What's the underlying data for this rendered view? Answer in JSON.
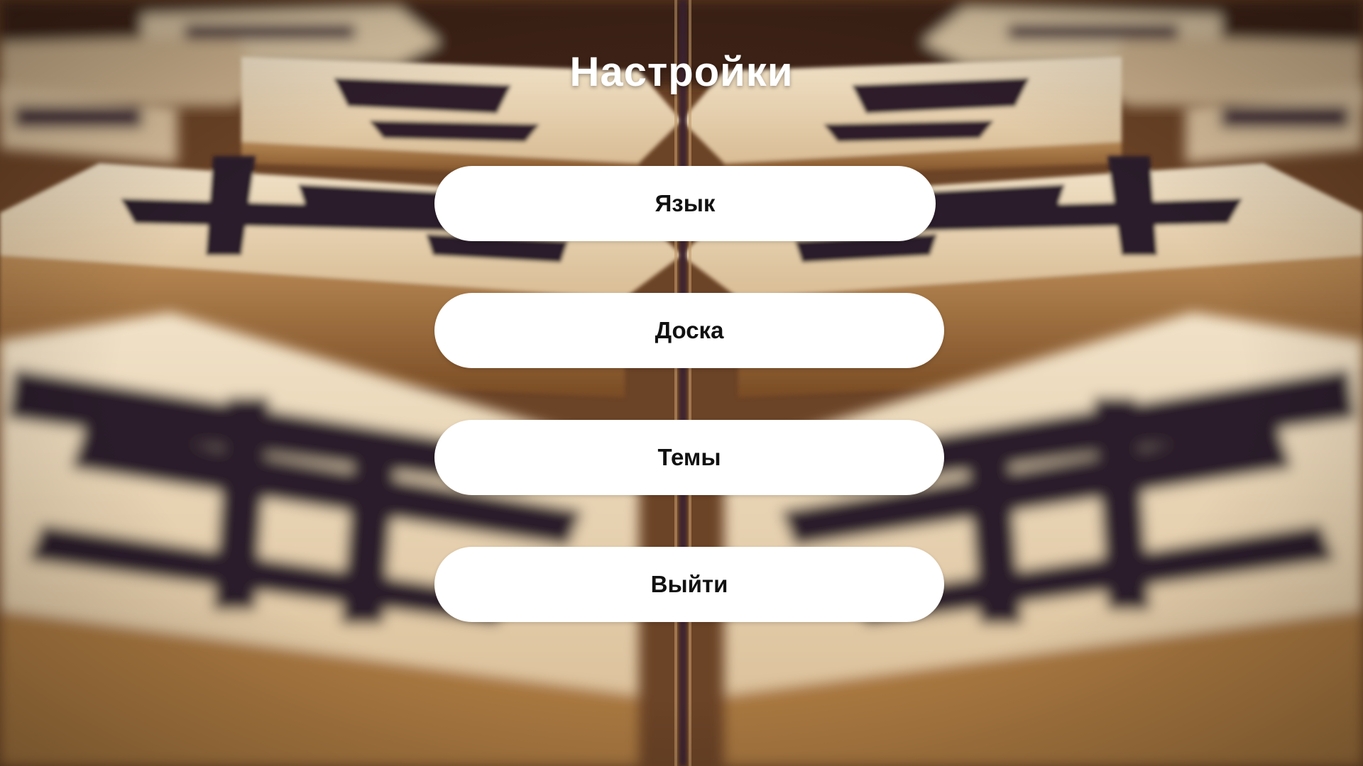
{
  "screen": {
    "title": "Настройки",
    "background": "blurred-shogi-pieces-photo"
  },
  "menu": {
    "items": [
      {
        "id": "language",
        "label": "Язык"
      },
      {
        "id": "board",
        "label": "Доска"
      },
      {
        "id": "themes",
        "label": "Темы"
      },
      {
        "id": "exit",
        "label": "Выйти"
      }
    ]
  },
  "colors": {
    "button_bg": "#ffffff",
    "button_text": "#111111",
    "title_text": "#ffffff",
    "wood_light": "#e8d5b9",
    "wood_dark": "#8a5a2e",
    "ink": "#2b1a2a"
  }
}
